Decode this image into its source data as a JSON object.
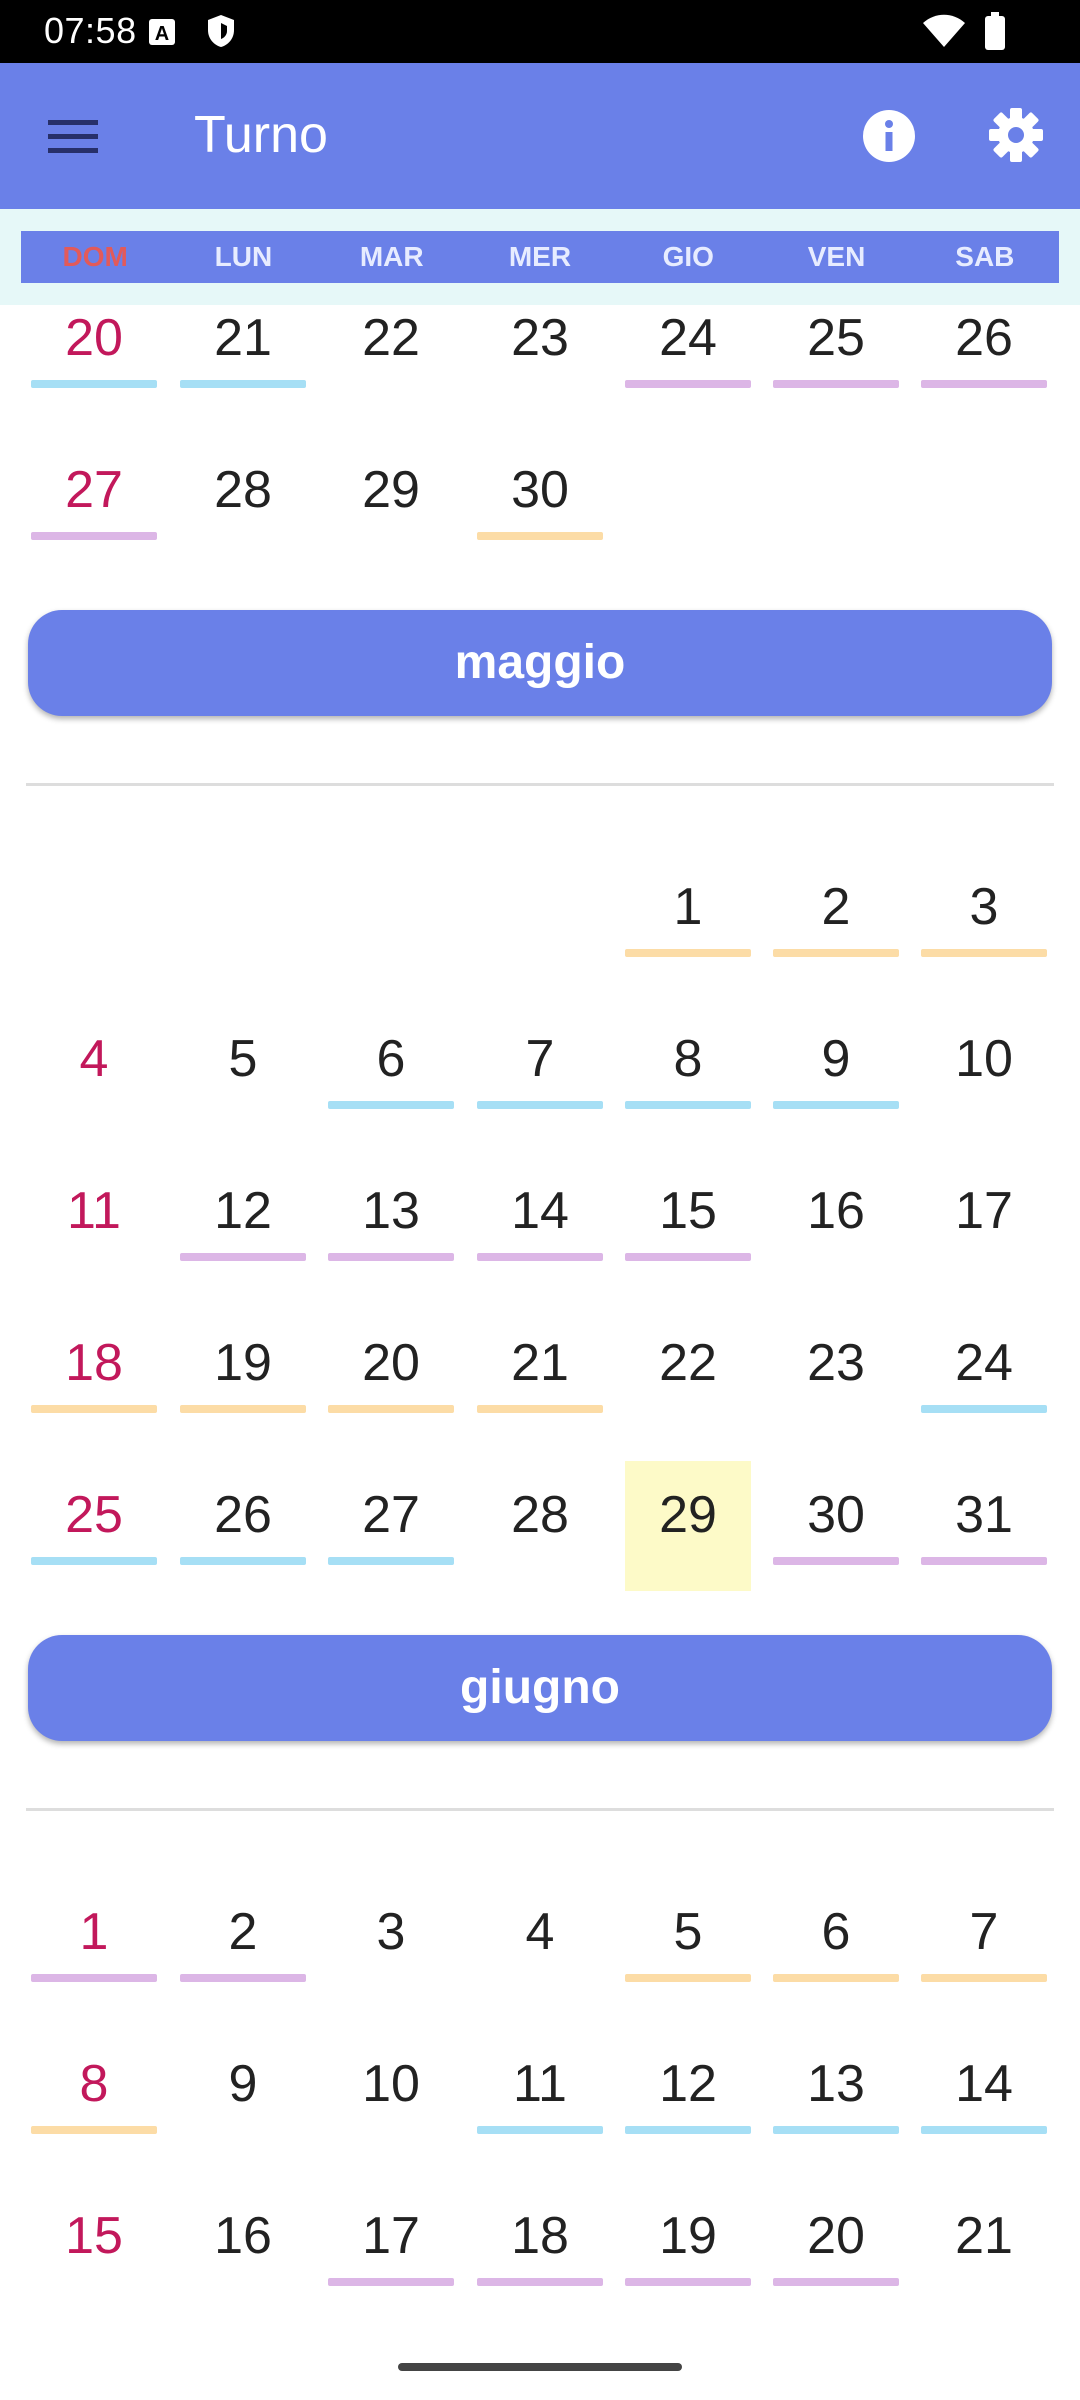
{
  "status_bar": {
    "time": "07:58",
    "icons": [
      "a-notification-icon",
      "shield-icon",
      "wifi-icon",
      "battery-icon"
    ]
  },
  "app_bar": {
    "title": "Turno",
    "menu_icon": "menu-icon",
    "info_icon": "info-icon",
    "settings_icon": "gear-icon"
  },
  "weekdays": [
    "DOM",
    "LUN",
    "MAR",
    "MER",
    "GIO",
    "VEN",
    "SAB"
  ],
  "colors": {
    "accent": "#6a80e8",
    "sunday": "#c2185b",
    "cyan": "#a6dff5",
    "purple": "#dcb6e6",
    "orange": "#fcdca6",
    "today": "#fdfac8"
  },
  "months": [
    {
      "label": "",
      "rows": [
        [
          {
            "d": "20",
            "c": "cyan"
          },
          {
            "d": "21",
            "c": "cyan"
          },
          {
            "d": "22",
            "c": ""
          },
          {
            "d": "23",
            "c": ""
          },
          {
            "d": "24",
            "c": "purple"
          },
          {
            "d": "25",
            "c": "purple"
          },
          {
            "d": "26",
            "c": "purple"
          }
        ],
        [
          {
            "d": "27",
            "c": "purple"
          },
          {
            "d": "28",
            "c": ""
          },
          {
            "d": "29",
            "c": ""
          },
          {
            "d": "30",
            "c": "orange"
          },
          null,
          null,
          null
        ]
      ]
    },
    {
      "label": "maggio",
      "rows": [
        [
          null,
          null,
          null,
          null,
          {
            "d": "1",
            "c": "orange"
          },
          {
            "d": "2",
            "c": "orange"
          },
          {
            "d": "3",
            "c": "orange"
          }
        ],
        [
          {
            "d": "4",
            "c": ""
          },
          {
            "d": "5",
            "c": ""
          },
          {
            "d": "6",
            "c": "cyan"
          },
          {
            "d": "7",
            "c": "cyan"
          },
          {
            "d": "8",
            "c": "cyan"
          },
          {
            "d": "9",
            "c": "cyan"
          },
          {
            "d": "10",
            "c": ""
          }
        ],
        [
          {
            "d": "11",
            "c": ""
          },
          {
            "d": "12",
            "c": "purple"
          },
          {
            "d": "13",
            "c": "purple"
          },
          {
            "d": "14",
            "c": "purple"
          },
          {
            "d": "15",
            "c": "purple"
          },
          {
            "d": "16",
            "c": ""
          },
          {
            "d": "17",
            "c": ""
          }
        ],
        [
          {
            "d": "18",
            "c": "orange"
          },
          {
            "d": "19",
            "c": "orange"
          },
          {
            "d": "20",
            "c": "orange"
          },
          {
            "d": "21",
            "c": "orange"
          },
          {
            "d": "22",
            "c": ""
          },
          {
            "d": "23",
            "c": ""
          },
          {
            "d": "24",
            "c": "cyan"
          }
        ],
        [
          {
            "d": "25",
            "c": "cyan"
          },
          {
            "d": "26",
            "c": "cyan"
          },
          {
            "d": "27",
            "c": "cyan"
          },
          {
            "d": "28",
            "c": ""
          },
          {
            "d": "29",
            "c": "",
            "today": true
          },
          {
            "d": "30",
            "c": "purple"
          },
          {
            "d": "31",
            "c": "purple"
          }
        ]
      ]
    },
    {
      "label": "giugno",
      "rows": [
        [
          {
            "d": "1",
            "c": "purple"
          },
          {
            "d": "2",
            "c": "purple"
          },
          {
            "d": "3",
            "c": ""
          },
          {
            "d": "4",
            "c": ""
          },
          {
            "d": "5",
            "c": "orange"
          },
          {
            "d": "6",
            "c": "orange"
          },
          {
            "d": "7",
            "c": "orange"
          }
        ],
        [
          {
            "d": "8",
            "c": "orange"
          },
          {
            "d": "9",
            "c": ""
          },
          {
            "d": "10",
            "c": ""
          },
          {
            "d": "11",
            "c": "cyan"
          },
          {
            "d": "12",
            "c": "cyan"
          },
          {
            "d": "13",
            "c": "cyan"
          },
          {
            "d": "14",
            "c": "cyan"
          }
        ],
        [
          {
            "d": "15",
            "c": ""
          },
          {
            "d": "16",
            "c": ""
          },
          {
            "d": "17",
            "c": "purple"
          },
          {
            "d": "18",
            "c": "purple"
          },
          {
            "d": "19",
            "c": "purple"
          },
          {
            "d": "20",
            "c": "purple"
          },
          {
            "d": "21",
            "c": ""
          }
        ]
      ]
    }
  ]
}
